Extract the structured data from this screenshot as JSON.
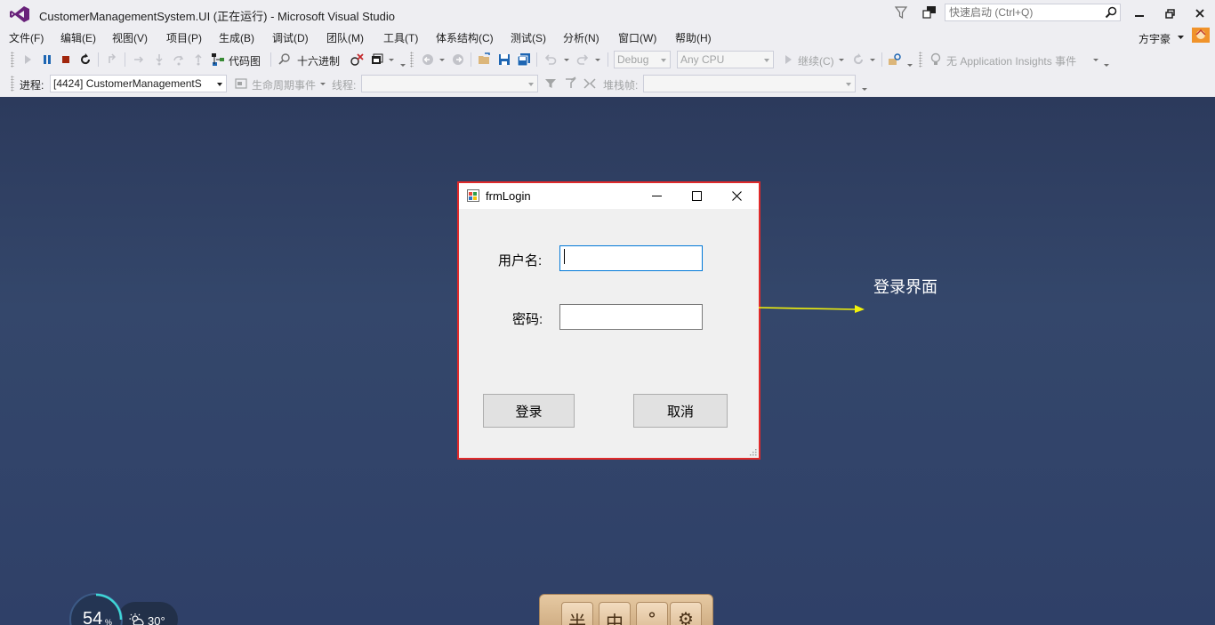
{
  "window": {
    "title": "CustomerManagementSystem.UI (正在运行) - Microsoft Visual Studio",
    "quick_launch_placeholder": "快速启动 (Ctrl+Q)",
    "user": "方宇豪"
  },
  "menu": [
    "文件(F)",
    "编辑(E)",
    "视图(V)",
    "项目(P)",
    "生成(B)",
    "调试(D)",
    "团队(M)",
    "工具(T)",
    "体系结构(C)",
    "测试(S)",
    "分析(N)",
    "窗口(W)",
    "帮助(H)"
  ],
  "toolbar1": {
    "code_map": "代码图",
    "hex": "十六进制",
    "config": "Debug",
    "platform": "Any CPU",
    "continue": "继续(C)",
    "insights": "无 Application Insights 事件"
  },
  "toolbar2": {
    "process_label": "进程:",
    "process_value": "[4424] CustomerManagementS",
    "lifecycle": "生命周期事件",
    "thread_label": "线程:",
    "stack_label": "堆栈帧:"
  },
  "login": {
    "title": "frmLogin",
    "username_label": "用户名:",
    "password_label": "密码:",
    "login_button": "登录",
    "cancel_button": "取消"
  },
  "annotation": {
    "text": "登录界面"
  },
  "widgets": {
    "cpu_value": "54",
    "cpu_unit": "%",
    "temperature": "30°",
    "ime_keys": [
      "半",
      "中",
      "°",
      "⚙"
    ]
  },
  "colors": {
    "accent": "#68217a",
    "desktop": "#2f4068",
    "highlight_border": "#e02a2a",
    "annotation_arrow": "#f2f20a"
  }
}
